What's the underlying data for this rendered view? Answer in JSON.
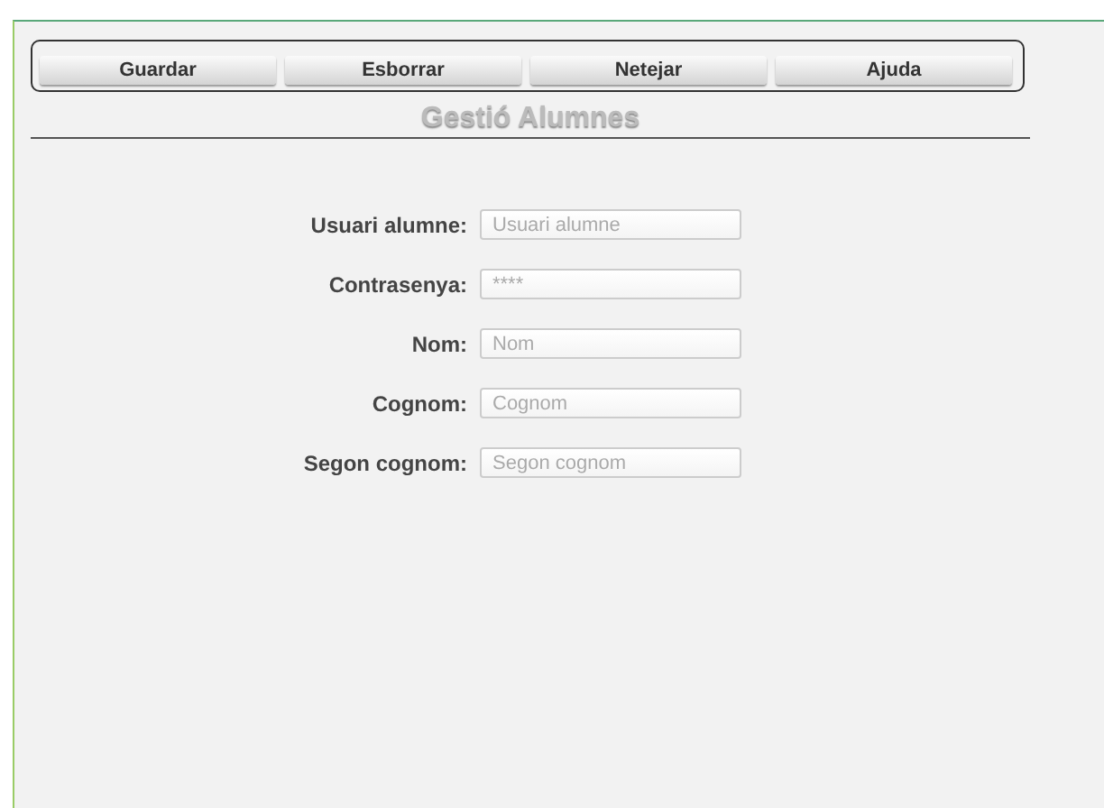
{
  "toolbar": {
    "buttons": [
      "Guardar",
      "Esborrar",
      "Netejar",
      "Ajuda"
    ]
  },
  "title": "Gestió Alumnes",
  "form": {
    "fields": [
      {
        "label": "Usuari alumne:",
        "placeholder": "Usuari alumne"
      },
      {
        "label": "Contrasenya:",
        "placeholder": "****"
      },
      {
        "label": "Nom:",
        "placeholder": "Nom"
      },
      {
        "label": "Cognom:",
        "placeholder": "Cognom"
      },
      {
        "label": "Segon cognom:",
        "placeholder": "Segon cognom"
      }
    ]
  }
}
